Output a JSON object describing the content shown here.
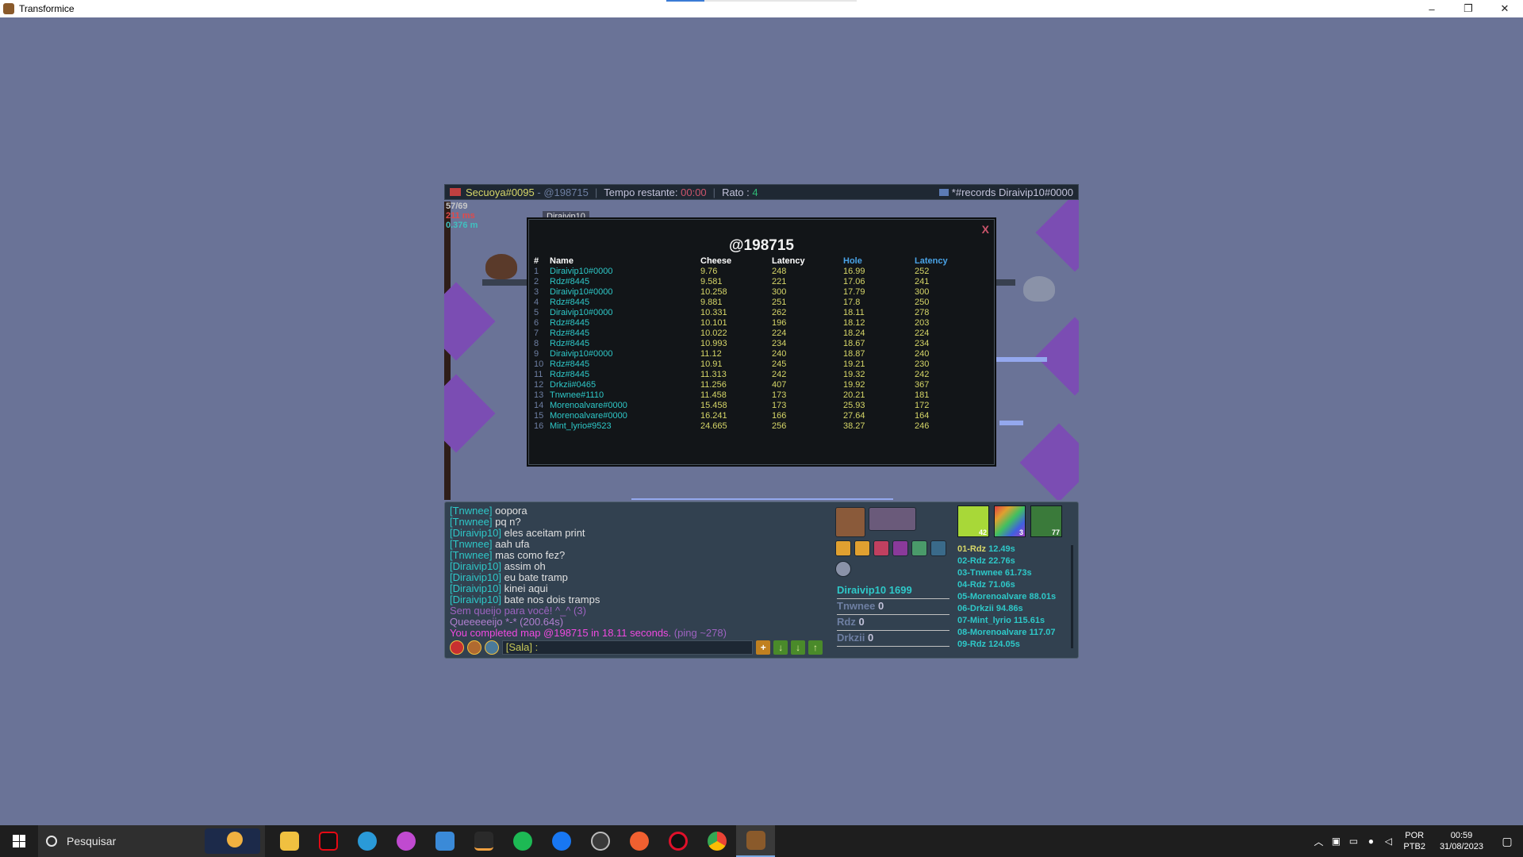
{
  "window": {
    "title": "Transformice",
    "minimize": "–",
    "restore": "❐",
    "close": "✕"
  },
  "hud": {
    "player": "Secuoya#0095",
    "map_code": "@198715",
    "time_label": "Tempo restante:",
    "time_value": "00:00",
    "rato_label": "Rato :",
    "rato_value": "4",
    "records_label": "*#records Diraivip10#0000",
    "stat1": "57/69",
    "stat2": "211 ms",
    "stat3": "0.376 m",
    "player_tag": "Diraivip10"
  },
  "records": {
    "title": "@198715",
    "close": "X",
    "headers": {
      "num": "#",
      "name": "Name",
      "cheese": "Cheese",
      "latency1": "Latency",
      "hole": "Hole",
      "latency2": "Latency"
    },
    "rows": [
      [
        "1",
        "Diraivip10#0000",
        "9.76",
        "248",
        "16.99",
        "252"
      ],
      [
        "2",
        "Rdz#8445",
        "9.581",
        "221",
        "17.06",
        "241"
      ],
      [
        "3",
        "Diraivip10#0000",
        "10.258",
        "300",
        "17.79",
        "300"
      ],
      [
        "4",
        "Rdz#8445",
        "9.881",
        "251",
        "17.8",
        "250"
      ],
      [
        "5",
        "Diraivip10#0000",
        "10.331",
        "262",
        "18.11",
        "278"
      ],
      [
        "6",
        "Rdz#8445",
        "10.101",
        "196",
        "18.12",
        "203"
      ],
      [
        "7",
        "Rdz#8445",
        "10.022",
        "224",
        "18.24",
        "224"
      ],
      [
        "8",
        "Rdz#8445",
        "10.993",
        "234",
        "18.67",
        "234"
      ],
      [
        "9",
        "Diraivip10#0000",
        "11.12",
        "240",
        "18.87",
        "240"
      ],
      [
        "10",
        "Rdz#8445",
        "10.91",
        "245",
        "19.21",
        "230"
      ],
      [
        "11",
        "Rdz#8445",
        "11.313",
        "242",
        "19.32",
        "242"
      ],
      [
        "12",
        "Drkzii#0465",
        "11.256",
        "407",
        "19.92",
        "367"
      ],
      [
        "13",
        "Tnwnee#1110",
        "11.458",
        "173",
        "20.21",
        "181"
      ],
      [
        "14",
        "Morenoalvare#0000",
        "15.458",
        "173",
        "25.93",
        "172"
      ],
      [
        "15",
        "Morenoalvare#0000",
        "16.241",
        "166",
        "27.64",
        "164"
      ],
      [
        "16",
        "Mint_lyrio#9523",
        "24.665",
        "256",
        "38.27",
        "246"
      ]
    ]
  },
  "chat": {
    "lines": [
      {
        "nick": "[Tnwnee]",
        "msg": "oopora"
      },
      {
        "nick": "[Tnwnee]",
        "msg": "pq n?"
      },
      {
        "nick": "[Diraivip10]",
        "msg": "eles aceitam print"
      },
      {
        "nick": "[Tnwnee]",
        "msg": "aah ufa"
      },
      {
        "nick": "[Tnwnee]",
        "msg": "mas como fez?"
      },
      {
        "nick": "[Diraivip10]",
        "msg": "assim oh"
      },
      {
        "nick": "[Diraivip10]",
        "msg": "eu bate tramp"
      },
      {
        "nick": "[Diraivip10]",
        "msg": "kinei aqui"
      },
      {
        "nick": "[Diraivip10]",
        "msg": "bate nos dois tramps"
      }
    ],
    "sys1": "Sem queijo para você! ^_^ (3)",
    "sys2": "Queeeeeijo *-* (200.64s)",
    "completed": "You completed map @198715 in 18.11 seconds.",
    "ping": "(ping ~278)",
    "input_prefix": "[Sala] :"
  },
  "scores": {
    "me_name": "Diraivip10",
    "me_value": "1699",
    "others": [
      {
        "name": "Tnwnee",
        "value": "0"
      },
      {
        "name": "Rdz",
        "value": "0"
      },
      {
        "name": "Drkzii",
        "value": "0"
      }
    ]
  },
  "badges": [
    {
      "count": "42",
      "color": "#a8d838"
    },
    {
      "count": "3",
      "color": "#7a6ad0"
    },
    {
      "count": "77",
      "color": "#3a7a3a"
    }
  ],
  "ranking": [
    {
      "name": "01-Rdz",
      "time": "12.49s"
    },
    {
      "name": "02-Rdz",
      "time": "22.76s"
    },
    {
      "name": "03-Tnwnee",
      "time": "61.73s"
    },
    {
      "name": "04-Rdz",
      "time": "71.06s"
    },
    {
      "name": "05-Morenoalvare",
      "time": "88.01s"
    },
    {
      "name": "06-Drkzii",
      "time": "94.86s"
    },
    {
      "name": "07-Mint_lyrio",
      "time": "115.61s"
    },
    {
      "name": "08-Morenoalvare",
      "time": "117.07"
    },
    {
      "name": "09-Rdz",
      "time": "124.05s"
    }
  ],
  "taskbar": {
    "search_placeholder": "Pesquisar",
    "lang_line1": "POR",
    "lang_line2": "PTB2",
    "time": "00:59",
    "date": "31/08/2023"
  }
}
